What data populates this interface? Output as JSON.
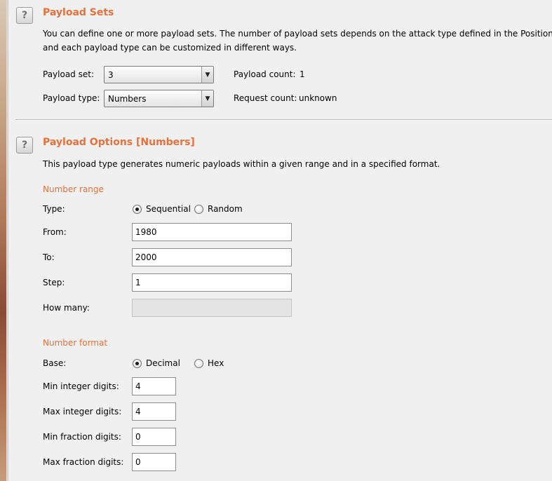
{
  "payload_sets": {
    "title": "Payload Sets",
    "description_line1": "You can define one or more payload sets. The number of payload sets depends on the attack type defined in the Positions tab,",
    "description_line2": "and each payload type can be customized in different ways.",
    "payload_set_label": "Payload set:",
    "payload_set_value": "3",
    "payload_type_label": "Payload type:",
    "payload_type_value": "Numbers",
    "payload_count_label": "Payload count:",
    "payload_count_value": "1",
    "request_count_label": "Request count:",
    "request_count_value": "unknown"
  },
  "payload_options": {
    "title": "Payload Options [Numbers]",
    "description": "This payload type generates numeric payloads within a given range and in a specified format.",
    "number_range": {
      "heading": "Number range",
      "type_label": "Type:",
      "type_options": [
        "Sequential",
        "Random"
      ],
      "type_selected": "Sequential",
      "from_label": "From:",
      "from_value": "1980",
      "to_label": "To:",
      "to_value": "2000",
      "step_label": "Step:",
      "step_value": "1",
      "how_many_label": "How many:",
      "how_many_value": ""
    },
    "number_format": {
      "heading": "Number format",
      "base_label": "Base:",
      "base_options": [
        "Decimal",
        "Hex"
      ],
      "base_selected": "Decimal",
      "min_integer_label": "Min integer digits:",
      "min_integer_value": "4",
      "max_integer_label": "Max integer digits:",
      "max_integer_value": "4",
      "min_fraction_label": "Min fraction digits:",
      "min_fraction_value": "0",
      "max_fraction_label": "Max fraction digits:",
      "max_fraction_value": "0"
    }
  },
  "icons": {
    "help": "help-icon",
    "dropdown": "chevron-down-icon"
  },
  "colors": {
    "accent": "#e8703a",
    "background": "#f0f0f0"
  }
}
